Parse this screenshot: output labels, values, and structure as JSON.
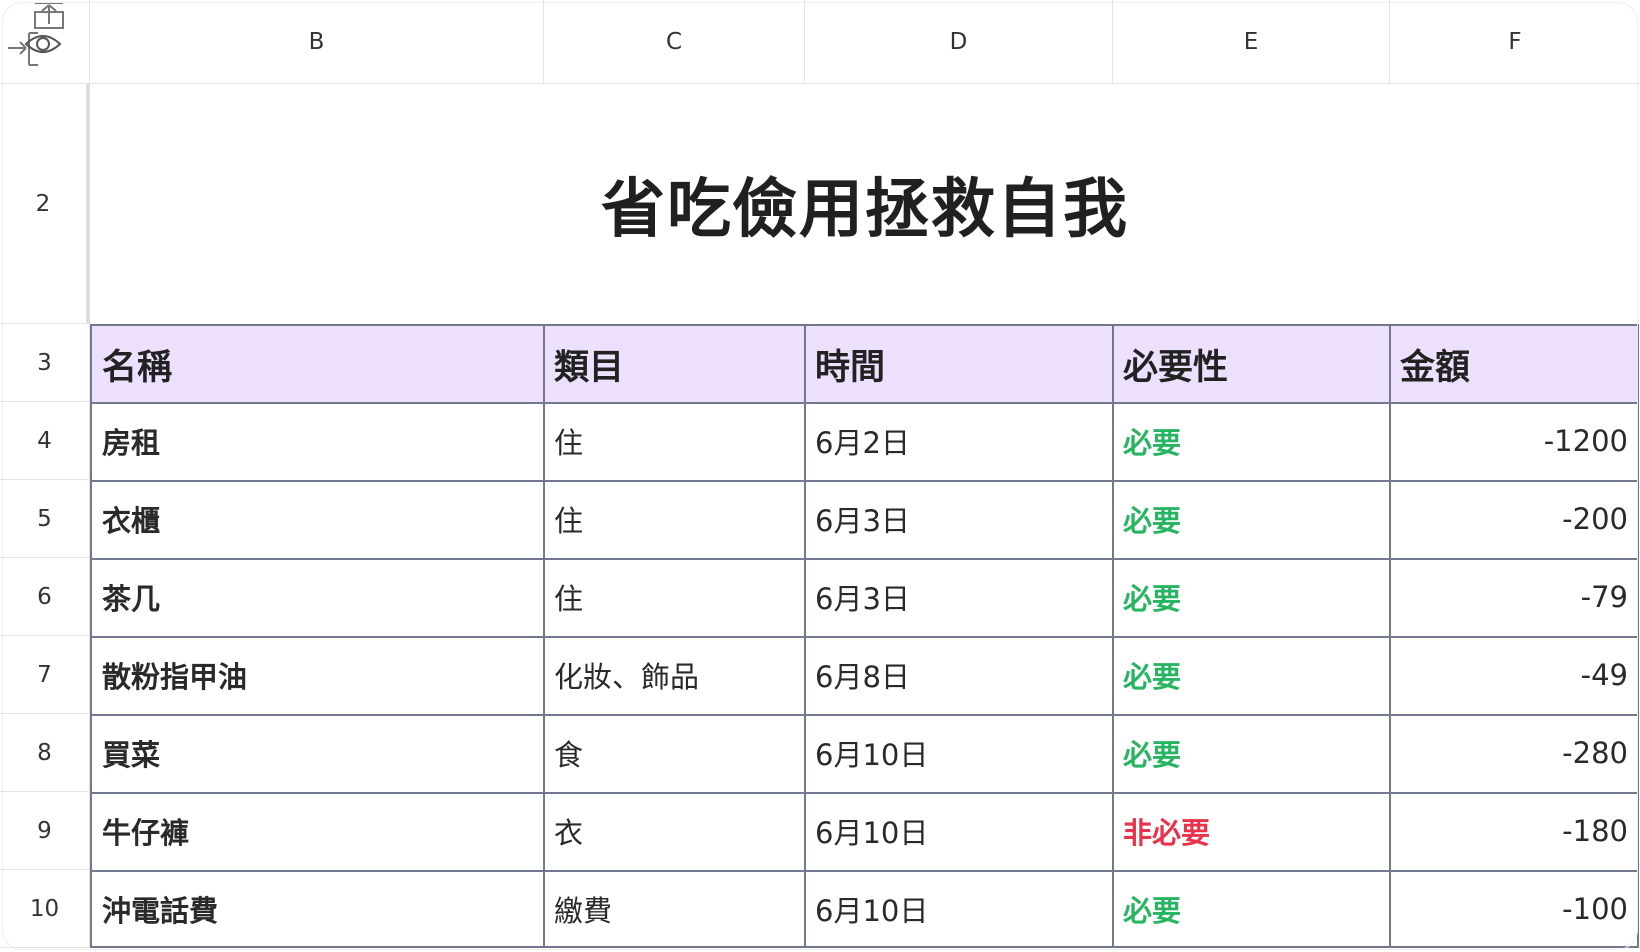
{
  "columns": [
    "B",
    "C",
    "D",
    "E",
    "F"
  ],
  "row_numbers": [
    "2",
    "3",
    "4",
    "5",
    "6",
    "7",
    "8",
    "9",
    "10"
  ],
  "title": "省吃儉用拯救自我",
  "table": {
    "headers": [
      "名稱",
      "類目",
      "時間",
      "必要性",
      "金額"
    ],
    "rows": [
      {
        "name": "房租",
        "category": "住",
        "date": "6月2日",
        "necessity": "必要",
        "amount": "-1200"
      },
      {
        "name": "衣櫃",
        "category": "住",
        "date": "6月3日",
        "necessity": "必要",
        "amount": "-200"
      },
      {
        "name": "茶几",
        "category": "住",
        "date": "6月3日",
        "necessity": "必要",
        "amount": "-79"
      },
      {
        "name": "散粉指甲油",
        "category": "化妝、飾品",
        "date": "6月8日",
        "necessity": "必要",
        "amount": "-49"
      },
      {
        "name": "買菜",
        "category": "食",
        "date": "6月10日",
        "necessity": "必要",
        "amount": "-280"
      },
      {
        "name": "牛仔褲",
        "category": "衣",
        "date": "6月10日",
        "necessity": "非必要",
        "amount": "-180"
      },
      {
        "name": "沖電話費",
        "category": "繳費",
        "date": "6月10日",
        "necessity": "必要",
        "amount": "-100"
      }
    ]
  },
  "colors": {
    "header_fill": "#ece0fd",
    "necessary": "#27b561",
    "unnecessary": "#e8334a",
    "grid": "#737790"
  },
  "icons": {
    "corner_top": "expand-rows-icon",
    "corner_bottom_left": "expand-columns-icon",
    "corner_bottom_right": "show-hidden-eye-icon"
  }
}
